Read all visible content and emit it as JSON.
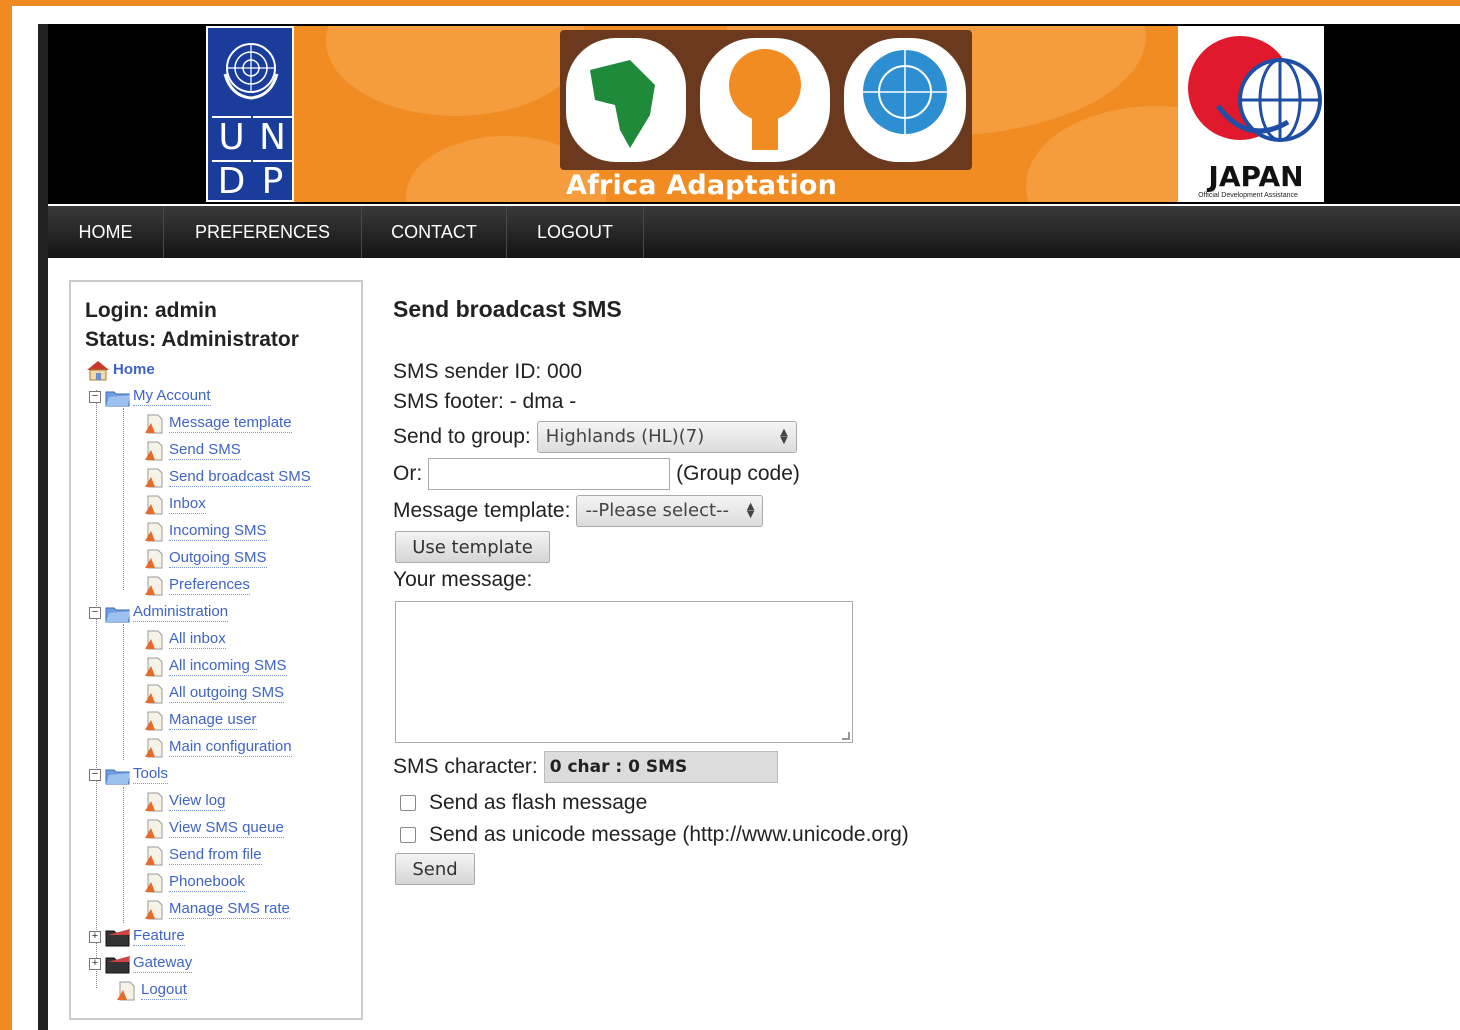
{
  "banner": {
    "undp_letters": [
      "U",
      "N",
      "D",
      "P"
    ],
    "programme_title": "Africa Adaptation Programme",
    "japan_title": "JAPAN",
    "japan_subtitle": "Official Development Assistance"
  },
  "nav": {
    "items": [
      "HOME",
      "PREFERENCES",
      "CONTACT",
      "LOGOUT"
    ]
  },
  "sidebar": {
    "login": "Login: admin",
    "status": "Status: Administrator",
    "home": "Home",
    "my_account": {
      "label": "My Account",
      "items": [
        "Message template",
        "Send SMS",
        "Send broadcast SMS",
        "Inbox",
        "Incoming SMS",
        "Outgoing SMS",
        "Preferences"
      ]
    },
    "administration": {
      "label": "Administration",
      "items": [
        "All inbox",
        "All incoming SMS",
        "All outgoing SMS",
        "Manage user",
        "Main configuration"
      ]
    },
    "tools": {
      "label": "Tools",
      "items": [
        "View log",
        "View SMS queue",
        "Send from file",
        "Phonebook",
        "Manage SMS rate"
      ]
    },
    "feature": "Feature",
    "gateway": "Gateway",
    "logout": "Logout"
  },
  "main": {
    "title": "Send broadcast SMS",
    "sender_id": "SMS sender ID: 000",
    "footer": "SMS footer: - dma -",
    "send_to_group_label": "Send to group:",
    "group_selected": "Highlands (HL)(7)",
    "or_label": "Or:",
    "group_code_value": "",
    "group_code_hint": "(Group code)",
    "template_label": "Message template:",
    "template_selected": "--Please select--",
    "use_template_button": "Use template",
    "your_message_label": "Your message:",
    "message_value": "",
    "sms_character_label": "SMS character:",
    "sms_character_value": "0 char : 0 SMS",
    "flash_label": "Send as flash message",
    "unicode_label": "Send as unicode message (http://www.unicode.org)",
    "send_button": "Send"
  },
  "colors": {
    "orange": "#ee8a1f",
    "undp_blue": "#1a3d9c",
    "link_blue": "#3f64c8",
    "nav_dark": "#1c1c1c"
  }
}
